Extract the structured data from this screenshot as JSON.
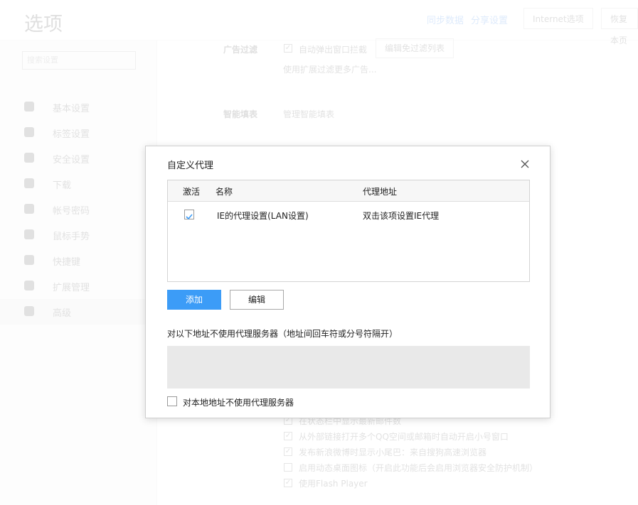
{
  "background": {
    "page_title": "选项",
    "header_links": [
      "同步数据",
      "分享设置"
    ],
    "header_buttons": [
      "Internet选项",
      "恢复本页"
    ],
    "search_placeholder": "搜索设置",
    "nav_items": [
      "基本设置",
      "标签设置",
      "安全设置",
      "下载",
      "帐号密码",
      "鼠标手势",
      "快捷键",
      "扩展管理",
      "高级"
    ],
    "active_nav_index": 8,
    "section_ad_filter": {
      "label": "广告过滤",
      "checkbox_label": "自动弹出窗口拦截",
      "button": "编辑免过滤列表",
      "link": "使用扩展过滤更多广告..."
    },
    "section_smart": {
      "label": "智能填表",
      "link": "管理智能填表"
    },
    "bottom_options": [
      {
        "label": "在状态栏中显示最新邮件数",
        "checked": true
      },
      {
        "label": "从外部链接打开多个QQ空间或邮箱时自动开启小号窗口",
        "checked": true
      },
      {
        "label": "发布新浪微博时显示小尾巴：来自搜狗高速浏览器",
        "checked": true
      },
      {
        "label": "启用动态桌面图标（开启此功能后会启用浏览器安全防护机制）",
        "checked": false
      },
      {
        "label": "使用Flash Player",
        "checked": true
      }
    ]
  },
  "dialog": {
    "title": "自定义代理",
    "close_icon": "close-icon",
    "columns": {
      "active": "激活",
      "name": "名称",
      "address": "代理地址"
    },
    "rows": [
      {
        "active": true,
        "name": "IE的代理设置(LAN设置)",
        "address": "双击该项设置IE代理"
      }
    ],
    "add_button": "添加",
    "edit_button": "编辑",
    "bypass_label": "对以下地址不使用代理服务器（地址间回车符或分号符隔开）",
    "bypass_value": "",
    "local_bypass_label": "对本地地址不使用代理服务器",
    "local_bypass_checked": false,
    "accent_color": "#3c9cf7"
  }
}
